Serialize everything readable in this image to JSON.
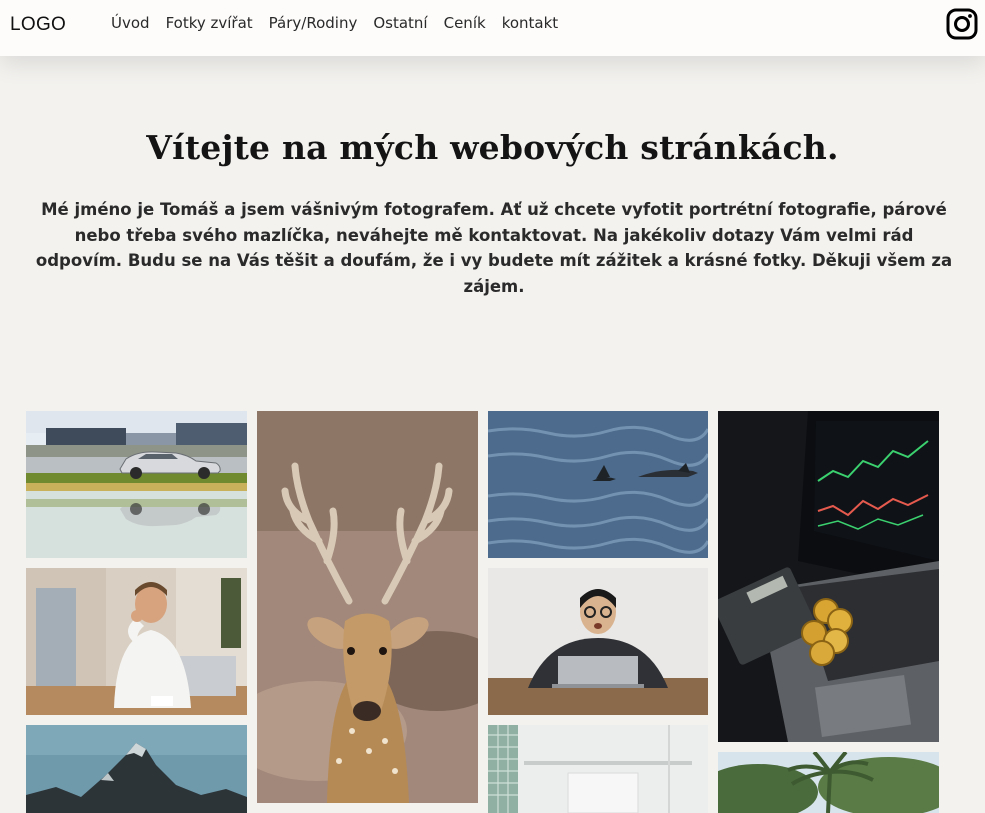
{
  "header": {
    "logo": "LOGO",
    "nav": [
      "Úvod",
      "Fotky zvířat",
      "Páry/Rodiny",
      "Ostatní",
      "Ceník",
      "kontakt"
    ],
    "social_icon": "instagram-icon"
  },
  "hero": {
    "title": "Vítejte na mých webových stránkách.",
    "text": "Mé jméno je Tomáš a jsem vášnivým fotografem. Ať už chcete vyfotit portrétní fotografie, párové nebo třeba svého mazlíčka, neváhejte mě kontaktovat. Na jakékoliv dotazy Vám velmi rád odpovím. Budu se na Vás těšit a doufám, že i vy budete mít zážitek a krásné fotky. Děkuji všem za zájem."
  },
  "colors": {
    "page_background": "#f3f2ef",
    "nav_background": "#fdfcfb",
    "text": "#1f1f1f"
  }
}
